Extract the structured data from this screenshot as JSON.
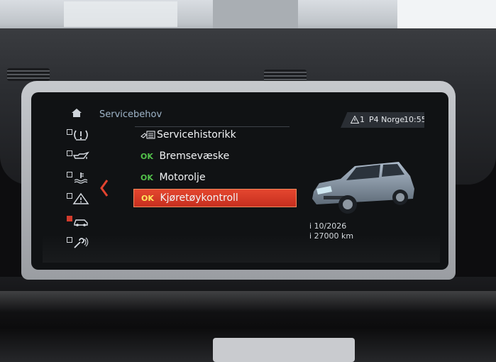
{
  "header": {
    "title": "Servicebehov",
    "status_warning_count": "1",
    "station": "P4 Norge",
    "time": "10:55"
  },
  "sidebar": {
    "items": [
      {
        "icon": "home-icon",
        "checked": false
      },
      {
        "icon": "tire-pressure-icon",
        "checked": false
      },
      {
        "icon": "oil-can-icon",
        "checked": false
      },
      {
        "icon": "coolant-icon",
        "checked": false
      },
      {
        "icon": "warning-triangle-icon",
        "checked": false
      },
      {
        "icon": "car-icon",
        "checked": true
      },
      {
        "icon": "wrench-icon",
        "checked": false
      }
    ]
  },
  "menu": {
    "items": [
      {
        "status": "",
        "label": "Servicehistorikk",
        "icon": "service-history-icon"
      },
      {
        "status": "OK",
        "label": "Bremsevæske"
      },
      {
        "status": "OK",
        "label": "Motorolje"
      },
      {
        "status": "OK",
        "label": "Kjøretøykontroll",
        "selected": true
      }
    ]
  },
  "details": {
    "due_date": "10/2026",
    "due_distance": "27000 km"
  },
  "colors": {
    "accent_selected": "#d63a27",
    "ok_green": "#52c04a",
    "title_blue": "#9fb5c9"
  }
}
